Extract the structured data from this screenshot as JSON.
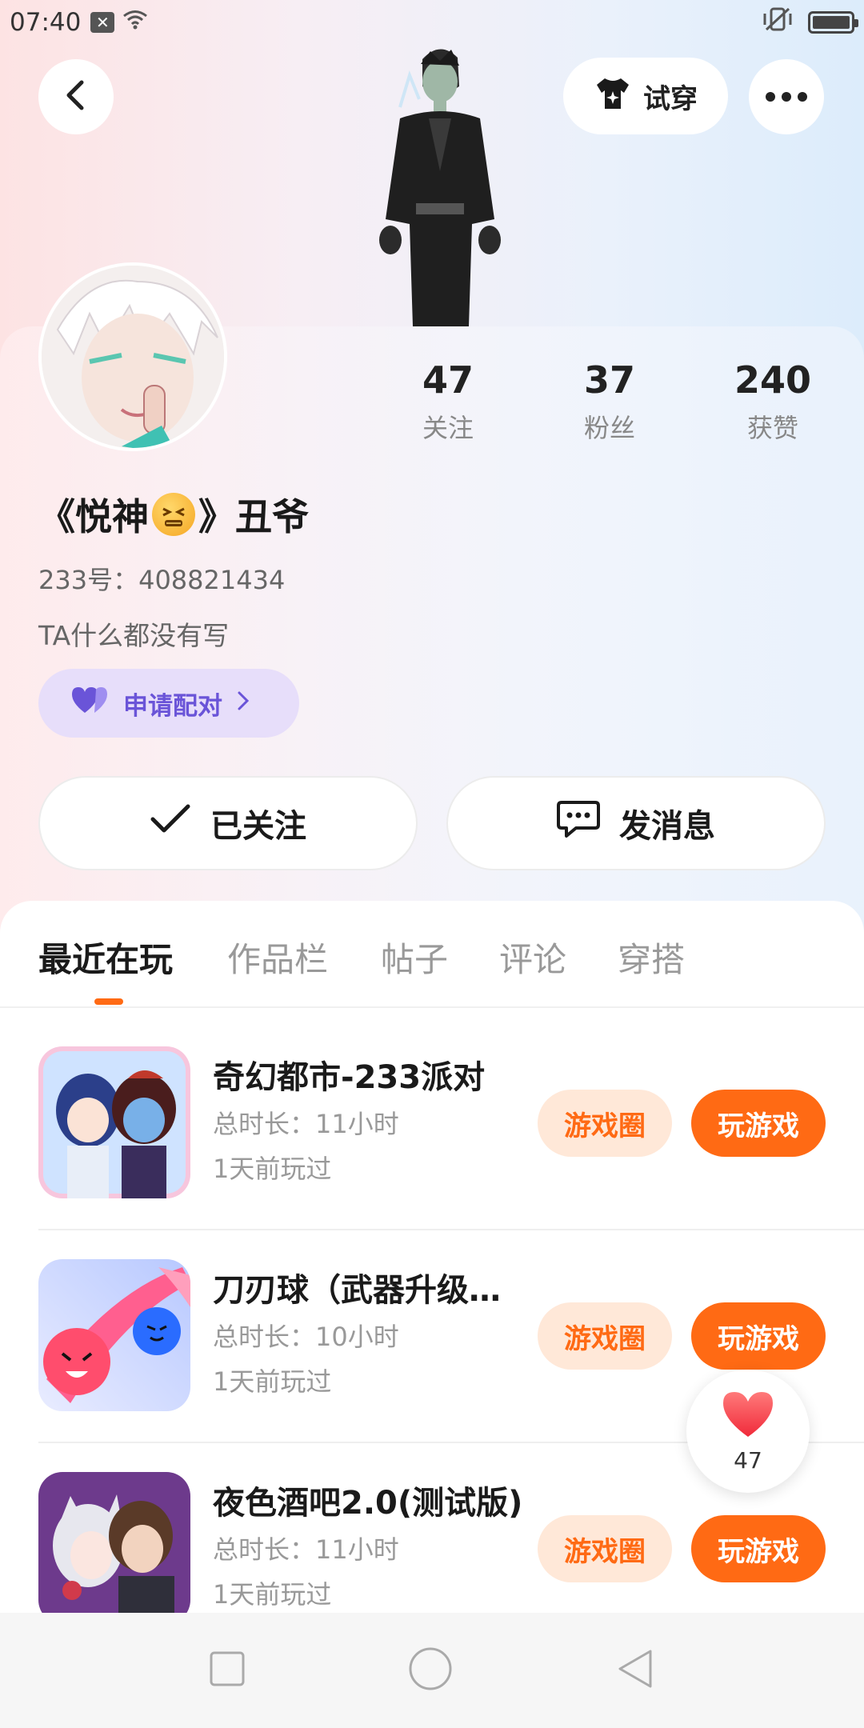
{
  "status_bar": {
    "time": "07:40"
  },
  "header": {
    "back_icon": "chevron-left-icon",
    "tryon_label": "试穿",
    "more_icon": "more-dots-icon"
  },
  "profile": {
    "stats": [
      {
        "num": "47",
        "label": "关注"
      },
      {
        "num": "37",
        "label": "粉丝"
      },
      {
        "num": "240",
        "label": "获赞"
      }
    ],
    "nickname_prefix": "《悦神",
    "nickname_suffix": "》丑爷",
    "uid": "233号：408821434",
    "bio": "TA什么都没有写",
    "pair_label": "申请配对",
    "follow_label": "已关注",
    "message_label": "发消息"
  },
  "tabs": [
    "最近在玩",
    "作品栏",
    "帖子",
    "评论",
    "穿搭"
  ],
  "games": [
    {
      "title": "奇幻都市-233派对",
      "duration": "总时长：11小时",
      "last_played": "1天前玩过",
      "circle_label": "游戏圈",
      "play_label": "玩游戏"
    },
    {
      "title": "刀刃球（武器升级…",
      "duration": "总时长：10小时",
      "last_played": "1天前玩过",
      "circle_label": "游戏圈",
      "play_label": "玩游戏"
    },
    {
      "title": "夜色酒吧2.0(测试版)",
      "duration": "总时长：11小时",
      "last_played": "1天前玩过",
      "circle_label": "游戏圈",
      "play_label": "玩游戏"
    }
  ],
  "like_float": {
    "count": "47"
  },
  "colors": {
    "accent": "#ff6a14",
    "accent_light": "#ffe8d8",
    "pair_bg": "#e7defa",
    "pair_text": "#6a54d8"
  }
}
